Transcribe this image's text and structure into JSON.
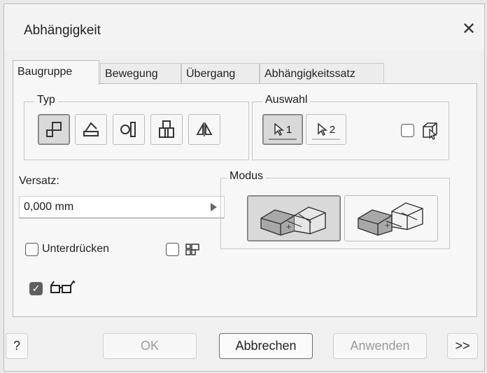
{
  "dialog": {
    "title": "Abhängigkeit",
    "close_symbol": "✕"
  },
  "tabs": [
    {
      "label": "Baugruppe",
      "active": true
    },
    {
      "label": "Bewegung",
      "active": false
    },
    {
      "label": "Übergang",
      "active": false
    },
    {
      "label": "Abhängigkeitssatz",
      "active": false
    }
  ],
  "typ": {
    "label": "Typ",
    "buttons": [
      {
        "icon": "mate-constraint-icon",
        "pressed": true
      },
      {
        "icon": "angle-constraint-icon",
        "pressed": false
      },
      {
        "icon": "tangent-constraint-icon",
        "pressed": false
      },
      {
        "icon": "insert-constraint-icon",
        "pressed": false
      },
      {
        "icon": "symmetry-constraint-icon",
        "pressed": false
      }
    ]
  },
  "auswahl": {
    "label": "Auswahl",
    "select1": "1",
    "select2": "2",
    "pick_part_first_checked": false
  },
  "versatz": {
    "label": "Versatz:",
    "value": "0,000 mm"
  },
  "modus": {
    "label": "Modus",
    "options": [
      {
        "icon": "mate-mode-icon",
        "pressed": true
      },
      {
        "icon": "flush-mode-icon",
        "pressed": false
      }
    ]
  },
  "options": {
    "unterdruecken_label": "Unterdrücken",
    "unterdruecken_checked": false,
    "show_preview_checked": false,
    "predict_offset_checked": true
  },
  "footer": {
    "help": "?",
    "ok": "OK",
    "cancel": "Abbrechen",
    "apply": "Anwenden",
    "more": ">>"
  }
}
